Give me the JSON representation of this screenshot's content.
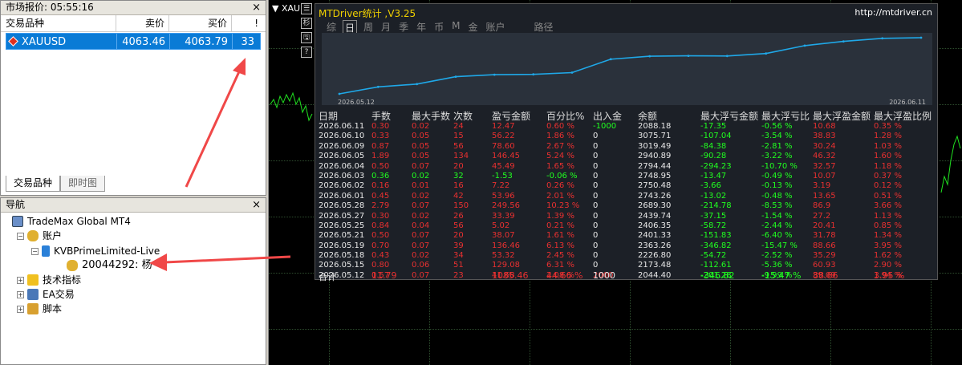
{
  "market_watch": {
    "title": "市场报价: 05:55:16",
    "close": "×",
    "columns": [
      "交易品种",
      "卖价",
      "买价",
      "!"
    ],
    "row": {
      "symbol": "XAUUSD",
      "bid": "4063.46",
      "ask": "4063.79",
      "spread": "33"
    },
    "tabs": [
      "交易品种",
      "即时图"
    ]
  },
  "navigator": {
    "title": "导航",
    "close": "×",
    "root": "TradeMax Global MT4",
    "accounts": "账户",
    "server": "KVBPrimeLimited-Live",
    "account": "20044292: 杨",
    "indicators": "技术指标",
    "ea": "EA交易",
    "scripts": "脚本"
  },
  "chart": {
    "symbol_label": "▼ XAUU",
    "side_buttons": [
      "☰",
      "杉",
      "🖫",
      "?"
    ],
    "panel": {
      "title": "MTDriver统计 ,V3.25",
      "url": "http://mtdriver.cn",
      "tabs": [
        "综",
        "日",
        "周",
        "月",
        "季",
        "年",
        "币",
        "M",
        "金",
        "账户",
        "",
        "路径"
      ],
      "active_tab": "日",
      "curve_start": "2026.05.12",
      "curve_end": "2026.06.11",
      "headers": [
        "日期",
        "手数",
        "最大手数",
        "次数",
        "盈亏金额",
        "百分比%",
        "出入金",
        "余额",
        "最大浮亏金额",
        "最大浮亏比",
        "最大浮盈金额",
        "最大浮盈比例"
      ],
      "rows": [
        [
          "2026.06.11",
          "0.30",
          "0.02",
          "24",
          "12.47",
          "0.60 %",
          "-1000",
          "2088.18",
          "-17.35",
          "-0.56 %",
          "10.68",
          "0.35 %"
        ],
        [
          "2026.06.10",
          "0.33",
          "0.05",
          "15",
          "56.22",
          "1.86 %",
          "0",
          "3075.71",
          "-107.04",
          "-3.54 %",
          "38.83",
          "1.28 %"
        ],
        [
          "2026.06.09",
          "0.87",
          "0.05",
          "56",
          "78.60",
          "2.67 %",
          "0",
          "3019.49",
          "-84.38",
          "-2.81 %",
          "30.24",
          "1.03 %"
        ],
        [
          "2026.06.05",
          "1.89",
          "0.05",
          "134",
          "146.45",
          "5.24 %",
          "0",
          "2940.89",
          "-90.28",
          "-3.22 %",
          "46.32",
          "1.60 %"
        ],
        [
          "2026.06.04",
          "0.50",
          "0.07",
          "20",
          "45.49",
          "1.65 %",
          "0",
          "2794.44",
          "-294.23",
          "-10.70 %",
          "32.57",
          "1.18 %"
        ],
        [
          "2026.06.03",
          "0.36",
          "0.02",
          "32",
          "-1.53",
          "-0.06 %",
          "0",
          "2748.95",
          "-13.47",
          "-0.49 %",
          "10.07",
          "0.37 %"
        ],
        [
          "2026.06.02",
          "0.16",
          "0.01",
          "16",
          "7.22",
          "0.26 %",
          "0",
          "2750.48",
          "-3.66",
          "-0.13 %",
          "3.19",
          "0.12 %"
        ],
        [
          "2026.06.01",
          "0.45",
          "0.02",
          "42",
          "53.96",
          "2.01 %",
          "0",
          "2743.26",
          "-13.02",
          "-0.48 %",
          "13.65",
          "0.51 %"
        ],
        [
          "2026.05.28",
          "2.79",
          "0.07",
          "150",
          "249.56",
          "10.23 %",
          "0",
          "2689.30",
          "-214.78",
          "-8.53 %",
          "86.9",
          "3.66 %"
        ],
        [
          "2026.05.27",
          "0.30",
          "0.02",
          "26",
          "33.39",
          "1.39 %",
          "0",
          "2439.74",
          "-37.15",
          "-1.54 %",
          "27.2",
          "1.13 %"
        ],
        [
          "2026.05.25",
          "0.84",
          "0.04",
          "56",
          "5.02",
          "0.21 %",
          "0",
          "2406.35",
          "-58.72",
          "-2.44 %",
          "20.41",
          "0.85 %"
        ],
        [
          "2026.05.21",
          "0.50",
          "0.07",
          "20",
          "38.07",
          "1.61 %",
          "0",
          "2401.33",
          "-151.83",
          "-6.40 %",
          "31.78",
          "1.34 %"
        ],
        [
          "2026.05.19",
          "0.70",
          "0.07",
          "39",
          "136.46",
          "6.13 %",
          "0",
          "2363.26",
          "-346.82",
          "-15.47 %",
          "88.66",
          "3.95 %"
        ],
        [
          "2026.05.18",
          "0.43",
          "0.02",
          "34",
          "53.32",
          "2.45 %",
          "0",
          "2226.80",
          "-54.72",
          "-2.52 %",
          "35.29",
          "1.62 %"
        ],
        [
          "2026.05.15",
          "0.80",
          "0.06",
          "51",
          "129.08",
          "6.31 %",
          "0",
          "2173.48",
          "-112.61",
          "-5.36 %",
          "60.93",
          "2.90 %"
        ],
        [
          "2026.05.12",
          "0.57",
          "0.07",
          "23",
          "41.68",
          "2.08 %",
          "2000",
          "2044.40",
          "-201.28",
          "-9.99 %",
          "39.09",
          "1.94 %"
        ]
      ],
      "total": [
        "合计",
        "11.79",
        "",
        "",
        "1085.46",
        "44.66 %",
        "1000",
        "",
        "-346.82",
        "-15.47 %",
        "88.66",
        "3.95 %"
      ]
    },
    "chart_data": {
      "type": "line",
      "x": [
        "2026.05.12",
        "2026.05.15",
        "2026.05.18",
        "2026.05.19",
        "2026.05.21",
        "2026.05.25",
        "2026.05.27",
        "2026.05.28",
        "2026.06.01",
        "2026.06.02",
        "2026.06.03",
        "2026.06.04",
        "2026.06.05",
        "2026.06.09",
        "2026.06.10",
        "2026.06.11"
      ],
      "values": [
        2044.4,
        2173.48,
        2226.8,
        2363.26,
        2401.33,
        2406.35,
        2439.74,
        2689.3,
        2743.26,
        2750.48,
        2748.95,
        2794.44,
        2940.89,
        3019.49,
        3075.71,
        3088.18
      ],
      "xlabel": "",
      "ylabel": "",
      "line_color": "#1fa8e8"
    },
    "colors": {
      "positive": "#e83030",
      "negative": "#20ff20",
      "neutral": "#e8e8e8",
      "title": "#f0d000",
      "highlight": "#0a7bd6"
    }
  }
}
